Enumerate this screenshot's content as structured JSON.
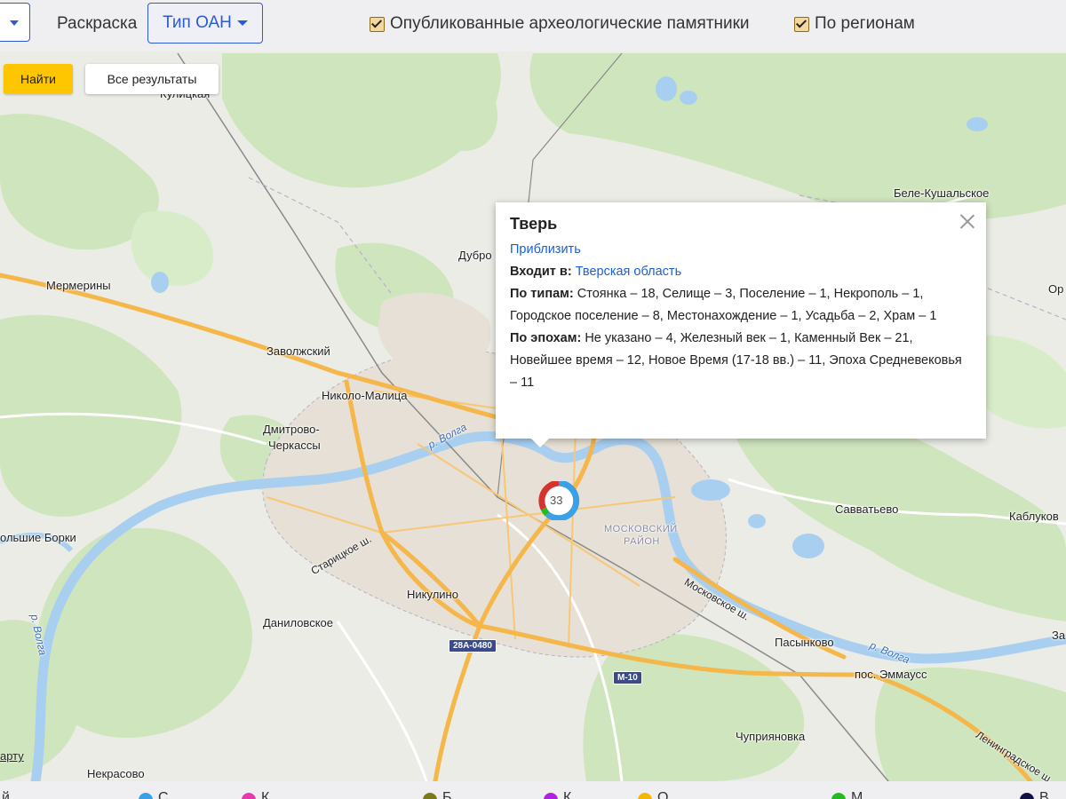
{
  "toolbar": {
    "coloring_label": "Раскраска",
    "type_button": "Тип ОАН",
    "checkbox_published": "Опубликованные археологические памятники",
    "checkbox_regions": "По регионам"
  },
  "search": {
    "find_label": "Найти",
    "all_results_label": "Все результаты"
  },
  "map": {
    "labels": {
      "kuliczy": "Кулицкая",
      "mermeriny": "Мермерины",
      "zavolzhsky": "Заволжский",
      "nikolo_malitsa": "Николо-Малица",
      "dmitrovo": "Дмитрово-",
      "cherkassy": "Черкассы",
      "dubrovki": "Дубро",
      "bolshie_borki": "ольшие Борки",
      "nikulino": "Никулино",
      "danilovskoe": "Даниловское",
      "nekrasovo": "Некрасово",
      "savvatyevo": "Савватьево",
      "kablukovo": "Каблуков",
      "pasynkovo": "Пасынково",
      "emmaus": "пос. Эммаусс",
      "chupriyanovka": "Чуприяновка",
      "bele_kushalskoe": "Беле-Кушальское",
      "or": "Ор",
      "za": "За",
      "moskovsky_rayon_1": "МОСКОВСКИЙ",
      "moskovsky_rayon_2": "РАЙОН",
      "volga_1": "р. Волга",
      "volga_2": "р. Волга",
      "volga_3": "р. Волга",
      "staritskoe": "Старицкое ш.",
      "moskovskoe": "Московское ш.",
      "leningradskoe": "Ленинградское ш.",
      "road_28a": "28А-0480",
      "road_m10": "М-10",
      "cluster_count": "33",
      "copyright_part": "арту"
    }
  },
  "balloon": {
    "title": "Тверь",
    "zoom_link": "Приблизить",
    "part_of_label": "Входит в",
    "part_of_value": "Тверская область",
    "by_types_label": "По типам",
    "by_types_value": "Стоянка – 18, Селище – 3, Поселение – 1, Некрополь – 1, Городское поселение – 8, Местонахождение – 1, Усадьба – 2, Храм – 1",
    "by_epochs_label": "По эпохам",
    "by_epochs_value": "Не указано – 4, Железный век – 1, Каменный Век – 21, Новейшее время – 12, Новое Время (17-18 вв.) – 11, Эпоха Средневековья – 11"
  },
  "legend": {
    "colors": [
      "#3aa0e8",
      "#e83ab0",
      "#7a7a18",
      "#b020e0",
      "#f5b800",
      "#22bb22",
      "#111144"
    ],
    "items": [
      "й",
      "С",
      "К",
      "Б",
      "К",
      "О",
      "М",
      "В"
    ]
  },
  "colors": {
    "accent": "#2f5bd1",
    "find_button": "#fdc600",
    "water": "#a8cff0",
    "forest": "#cfe6bf",
    "road_major": "#f5b64a",
    "link": "#1a5fd6"
  }
}
